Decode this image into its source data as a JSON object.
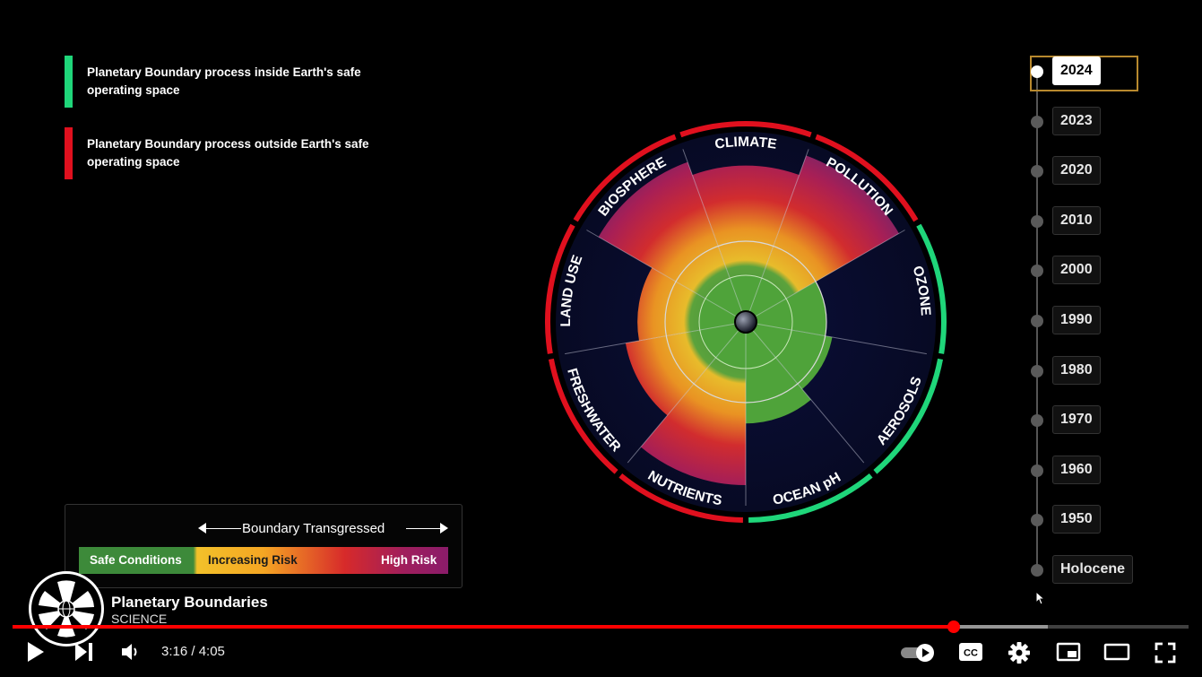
{
  "legend": {
    "inside_text_1": "Planetary Boundary process inside Earth's safe",
    "inside_text_2": "operating space",
    "outside_text_1": "Planetary Boundary process outside Earth's safe",
    "outside_text_2": "operating space",
    "inside_color": "#1fd67a",
    "outside_color": "#e0101e"
  },
  "risk_scale": {
    "title": "Boundary Transgressed",
    "safe": "Safe Conditions",
    "increasing": "Increasing Risk",
    "high": "High Risk"
  },
  "wheel": {
    "segments": [
      {
        "label": "CLIMATE",
        "status": "outside",
        "level": 0.8
      },
      {
        "label": "POLLUTION",
        "status": "outside",
        "level": 0.95
      },
      {
        "label": "OZONE",
        "status": "inside",
        "level": 0.25
      },
      {
        "label": "AEROSOLS",
        "status": "inside",
        "level": 0.3
      },
      {
        "label": "OCEAN pH",
        "status": "inside",
        "level": 0.4
      },
      {
        "label": "NUTRIENTS",
        "status": "outside",
        "level": 0.85
      },
      {
        "label": "FRESHWATER",
        "status": "outside",
        "level": 0.55
      },
      {
        "label": "LAND USE",
        "status": "outside",
        "level": 0.45
      },
      {
        "label": "BIOSPHERE",
        "status": "outside",
        "level": 0.9
      }
    ]
  },
  "timeline": {
    "selected": "2024",
    "years": [
      "2024",
      "2023",
      "2020",
      "2010",
      "2000",
      "1990",
      "1980",
      "1970",
      "1960",
      "1950",
      "Holocene"
    ]
  },
  "channel": {
    "name": "Planetary Boundaries",
    "subtitle": "SCIENCE"
  },
  "player": {
    "current_time": "3:16",
    "duration": "4:05",
    "time_display": "3:16 / 4:05",
    "progress": 0.8,
    "buffered": 0.88,
    "icons": [
      "play-icon",
      "next-icon",
      "volume-icon",
      "autoplay-toggle-icon",
      "captions-icon",
      "settings-icon",
      "miniplayer-icon",
      "theater-icon",
      "fullscreen-icon"
    ]
  }
}
